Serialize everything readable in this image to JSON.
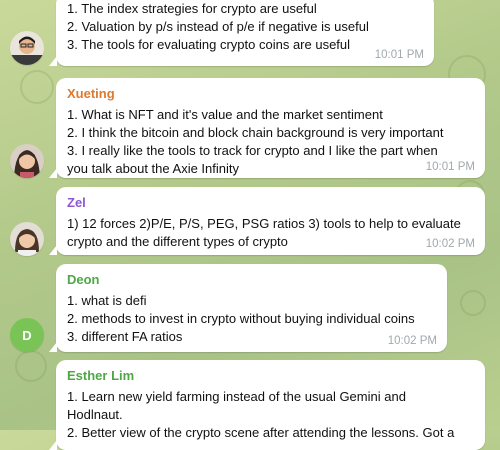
{
  "colors": {
    "xueting": "#de7a2f",
    "zel": "#8e55d6",
    "deon": "#4fa845",
    "esther": "#4fa845",
    "time": "#a0a9ad"
  },
  "messages": [
    {
      "sender": "",
      "lines": [
        "1. The index strategies for crypto are useful",
        "2. Valuation by p/s instead of p/e if negative is useful",
        "3. The tools for evaluating crypto coins are useful"
      ],
      "time": "10:01 PM",
      "avatar": "photo"
    },
    {
      "sender": "Xueting",
      "lines": [
        "1. What is NFT and it's value and the market sentiment",
        "2. I think the bitcoin and block chain background is very important",
        "3. I really like the tools to track for crypto and I like the part when",
        "you talk about the Axie Infinity"
      ],
      "time": "10:01 PM",
      "avatar": "photo"
    },
    {
      "sender": "Zel",
      "lines": [
        "1) 12 forces   2)P/E, P/S, PEG, PSG ratios  3) tools to help to evaluate",
        "crypto and the different types of crypto"
      ],
      "time": "10:02 PM",
      "avatar": "photo"
    },
    {
      "sender": "Deon",
      "lines": [
        "1. what is defi",
        "2. methods to invest in crypto without buying individual coins",
        "3. different FA ratios"
      ],
      "time": "10:02 PM",
      "avatar_letter": "D"
    },
    {
      "sender": "Esther Lim",
      "lines": [
        "1. Learn new yield farming instead of the usual Gemini and",
        "Hodlnaut.",
        "2. Better view of the crypto scene after attending the lessons. Got a"
      ],
      "time": "",
      "avatar": "none"
    }
  ]
}
